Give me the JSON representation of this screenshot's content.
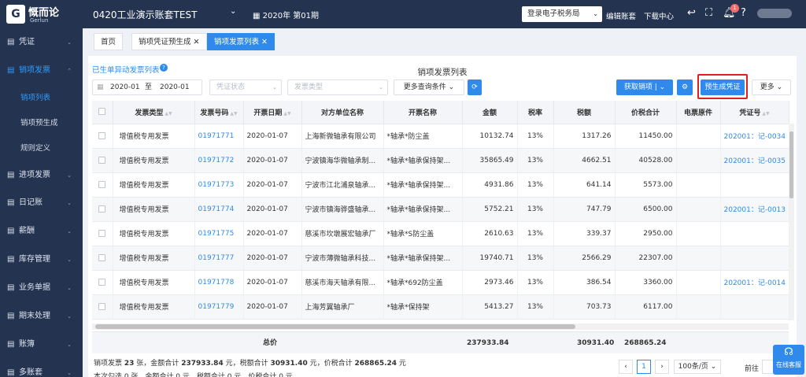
{
  "brand": {
    "mark": "G",
    "name_cn": "慨而论",
    "name_en": "Gerlun"
  },
  "top": {
    "account": "0420工业演示账套TEST",
    "period": "2020年 第01期",
    "tax_bureau": "登录电子税务局",
    "edit_account": "编辑账套",
    "download_center": "下载中心",
    "notif_count": "1"
  },
  "sidebar": {
    "items": [
      {
        "icon": "▤",
        "label": "凭证"
      },
      {
        "icon": "▤",
        "label": "销项发票"
      },
      {
        "icon": "▤",
        "label": "进项发票"
      },
      {
        "icon": "▤",
        "label": "日记账"
      },
      {
        "icon": "▤",
        "label": "薪酬"
      },
      {
        "icon": "▤",
        "label": "库存管理"
      },
      {
        "icon": "▤",
        "label": "业务单据"
      },
      {
        "icon": "▤",
        "label": "期末处理"
      },
      {
        "icon": "▤",
        "label": "账簿"
      },
      {
        "icon": "▤",
        "label": "多账套"
      }
    ],
    "sub": [
      "销项列表",
      "销项预生成",
      "规则定义"
    ]
  },
  "tabs": {
    "home": "首页",
    "t1": "销项凭证预生成",
    "t2": "销项发票列表"
  },
  "page": {
    "link": "已生单异动发票列表",
    "title": "销项发票列表",
    "date_from": "2020-01",
    "date_to_label": "至",
    "date_to": "2020-01",
    "voucher_status": "凭证状态",
    "invoice_type": "发票类型",
    "more_query": "更多查询条件",
    "fetch": "获取销项",
    "pregen": "预生成凭证",
    "more": "更多"
  },
  "table": {
    "headers": [
      "发票类型",
      "发票号码",
      "开票日期",
      "对方单位名称",
      "开票名称",
      "金额",
      "税率",
      "税额",
      "价税合计",
      "电票原件",
      "凭证号"
    ],
    "rows": [
      [
        "增值税专用发票",
        "01971771",
        "2020-01-07",
        "上海新微轴承有限公司",
        "*轴承*防尘盖",
        "10132.74",
        "13%",
        "1317.26",
        "11450.00",
        "",
        "202001：记-0034"
      ],
      [
        "增值税专用发票",
        "01971772",
        "2020-01-07",
        "宁波镇海华微轴承制...",
        "*轴承*轴承保持架...",
        "35865.49",
        "13%",
        "4662.51",
        "40528.00",
        "",
        "202001：记-0035"
      ],
      [
        "增值税专用发票",
        "01971773",
        "2020-01-07",
        "宁波市江北浦泉轴承...",
        "*轴承*轴承保持架...",
        "4931.86",
        "13%",
        "641.14",
        "5573.00",
        "",
        ""
      ],
      [
        "增值税专用发票",
        "01971774",
        "2020-01-07",
        "宁波市镇海骅盛轴承...",
        "*轴承*轴承保持架...",
        "5752.21",
        "13%",
        "747.79",
        "6500.00",
        "",
        "202001：记-0013"
      ],
      [
        "增值税专用发票",
        "01971775",
        "2020-01-07",
        "慈溪市坎墩展宏轴承厂",
        "*轴承*S防尘盖",
        "2610.63",
        "13%",
        "339.37",
        "2950.00",
        "",
        ""
      ],
      [
        "增值税专用发票",
        "01971777",
        "2020-01-07",
        "宁波市薄微轴承科技...",
        "*轴承*轴承保持架...",
        "19740.71",
        "13%",
        "2566.29",
        "22307.00",
        "",
        ""
      ],
      [
        "增值税专用发票",
        "01971778",
        "2020-01-07",
        "慈溪市海天轴承有限...",
        "*轴承*692防尘盖",
        "2973.46",
        "13%",
        "386.54",
        "3360.00",
        "",
        "202001：记-0014"
      ],
      [
        "增值税专用发票",
        "01971779",
        "2020-01-07",
        "上海芳翼轴承厂",
        "*轴承*保持架",
        "5413.27",
        "13%",
        "703.73",
        "6117.00",
        "",
        ""
      ]
    ],
    "total_label": "总价",
    "total_amount": "237933.84",
    "total_tax": "30931.40",
    "total_sum": "268865.24"
  },
  "summary": {
    "label": "销项发票",
    "count": "23",
    "unit": "张，金额合计",
    "amount": "237933.84",
    "unit2": "元，税额合计",
    "tax": "30931.40",
    "unit3": "元，价税合计",
    "sum": "268865.24",
    "unit4": "元",
    "line2": "本次勾选 0 张，金额合计 0 元，税额合计 0 元，价税合计 0 元"
  },
  "pager": {
    "page": "1",
    "per_page": "100条/页",
    "goto": "前往"
  },
  "online_service": "在线客服"
}
